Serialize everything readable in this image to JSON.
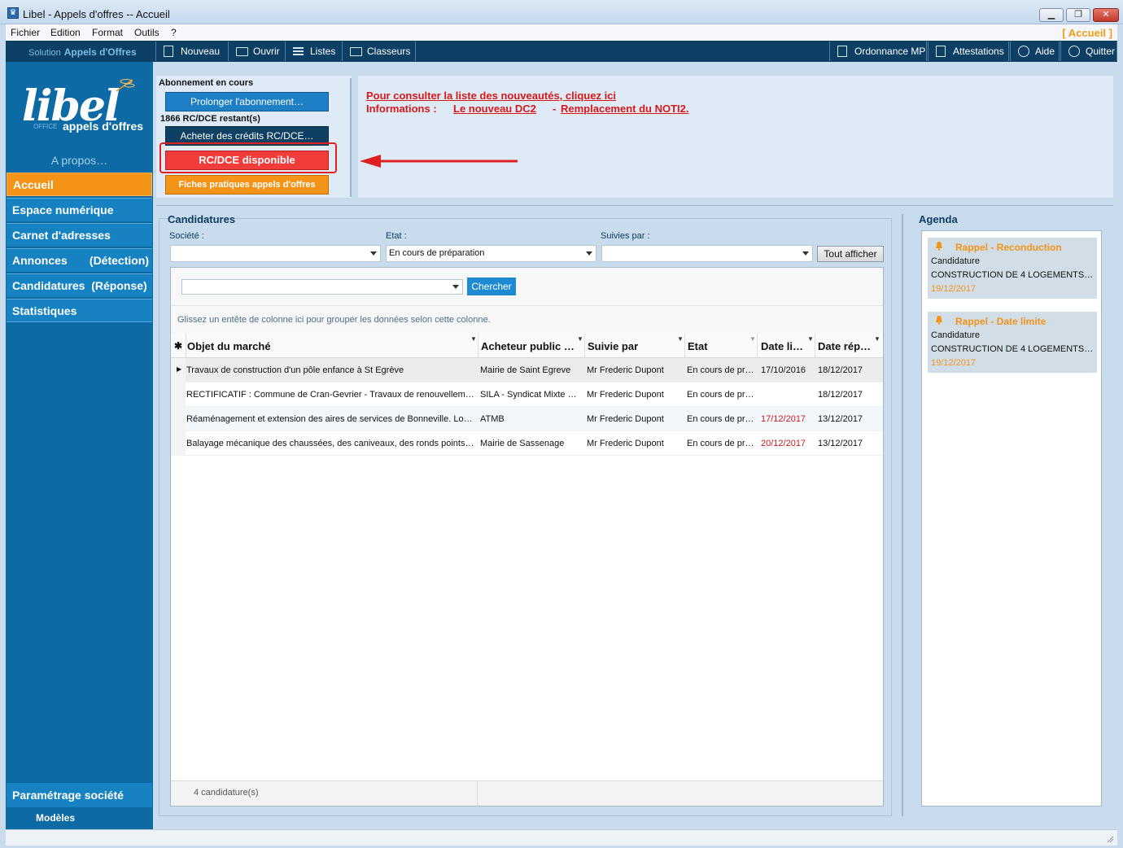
{
  "window": {
    "title": "Libel - Appels d'offres -- Accueil"
  },
  "menu": {
    "items": [
      "Fichier",
      "Edition",
      "Format",
      "Outils",
      "?"
    ],
    "breadcrumb": "[ Accueil ]"
  },
  "toolbar": {
    "solution_prefix": "Solution",
    "solution_name": "Appels d'Offres",
    "left_buttons": [
      "Nouveau",
      "Ouvrir",
      "Listes",
      "Classeurs"
    ],
    "right_buttons": [
      "Ordonnance MP",
      "Attestations",
      "Aide",
      "Quitter"
    ]
  },
  "logo": {
    "main": "libel",
    "sub": "appels d'offres",
    "office": "OFFICE"
  },
  "sidebar": {
    "apropos": "A propos…",
    "items": [
      {
        "label": "Accueil",
        "active": true
      },
      {
        "label": "Espace numérique"
      },
      {
        "label": "Carnet d'adresses"
      },
      {
        "label": "Annonces       (Détection)"
      },
      {
        "label": "Candidatures  (Réponse)"
      },
      {
        "label": "Statistiques"
      }
    ],
    "param_label": "Paramétrage société",
    "modeles_label": "Modèles"
  },
  "abonnement": {
    "title": "Abonnement en cours",
    "prolonger": "Prolonger l'abonnement…",
    "remaining": "1866 RC/DCE restant(s)",
    "acheter": "Acheter des crédits RC/DCE…",
    "rc_disponible": "RC/DCE disponible",
    "fiches": "Fiches pratiques appels d'offres"
  },
  "info": {
    "link1": "Pour consulter la liste des nouveautés, cliquez ici",
    "prefix": "Informations :",
    "link2": "Le nouveau DC2",
    "separator": "-",
    "link3": "Remplacement du NOTI2."
  },
  "candidatures": {
    "title": "Candidatures",
    "filters": {
      "societe_label": "Société :",
      "societe_value": "",
      "etat_label": "Etat :",
      "etat_value": "En cours de préparation",
      "suivies_label": "Suivies par :",
      "suivies_value": "",
      "tout_afficher": "Tout afficher"
    },
    "search": {
      "value": "",
      "button": "Chercher"
    },
    "group_hint": "Glissez un entête de colonne ici pour grouper les données selon cette colonne.",
    "columns": [
      "Objet du marché",
      "Acheteur public …",
      "Suivie par",
      "Etat",
      "Date li…",
      "Date rép…"
    ],
    "rows": [
      {
        "objet": "Travaux de construction d'un pôle enfance à St Egrève",
        "acheteur": "Mairie de Saint Egreve",
        "suivie": "Mr Frederic Dupont",
        "etat": "En cours de pr…",
        "date_limite": "17/10/2016",
        "date_limite_late": false,
        "date_rep": "18/12/2017",
        "current": true
      },
      {
        "objet": "RECTIFICATIF : Commune de Cran-Gevrier - Travaux de renouvellement…",
        "acheteur": "SILA - Syndicat Mixte d…",
        "suivie": "Mr Frederic Dupont",
        "etat": "En cours de pr…",
        "date_limite": "",
        "date_limite_late": false,
        "date_rep": "18/12/2017",
        "current": false
      },
      {
        "objet": "Réaménagement et extension des aires de services de Bonneville. Lot 1…",
        "acheteur": "ATMB",
        "suivie": "Mr Frederic Dupont",
        "etat": "En cours de pr…",
        "date_limite": "17/12/2017",
        "date_limite_late": true,
        "date_rep": "13/12/2017",
        "current": false
      },
      {
        "objet": "Balayage mécanique des chaussées, des caniveaux, des ronds points e…",
        "acheteur": "Mairie de Sassenage",
        "suivie": "Mr Frederic Dupont",
        "etat": "En cours de pr…",
        "date_limite": "20/12/2017",
        "date_limite_late": true,
        "date_rep": "13/12/2017",
        "current": false
      }
    ],
    "count": "4 candidature(s)"
  },
  "agenda": {
    "title": "Agenda",
    "items": [
      {
        "title": "Rappel - Reconduction",
        "type": "Candidature",
        "desc": "CONSTRUCTION DE 4 LOGEMENTS IN…",
        "date": "19/12/2017"
      },
      {
        "title": "Rappel - Date limite",
        "type": "Candidature",
        "desc": "CONSTRUCTION DE 4 LOGEMENTS IN…",
        "date": "19/12/2017"
      }
    ]
  },
  "colors": {
    "sidebar": "#0d6aa4",
    "accent": "#f39419",
    "toolbar": "#0d3e63",
    "alert_red": "#f23c3c",
    "link_red": "#d81818"
  }
}
